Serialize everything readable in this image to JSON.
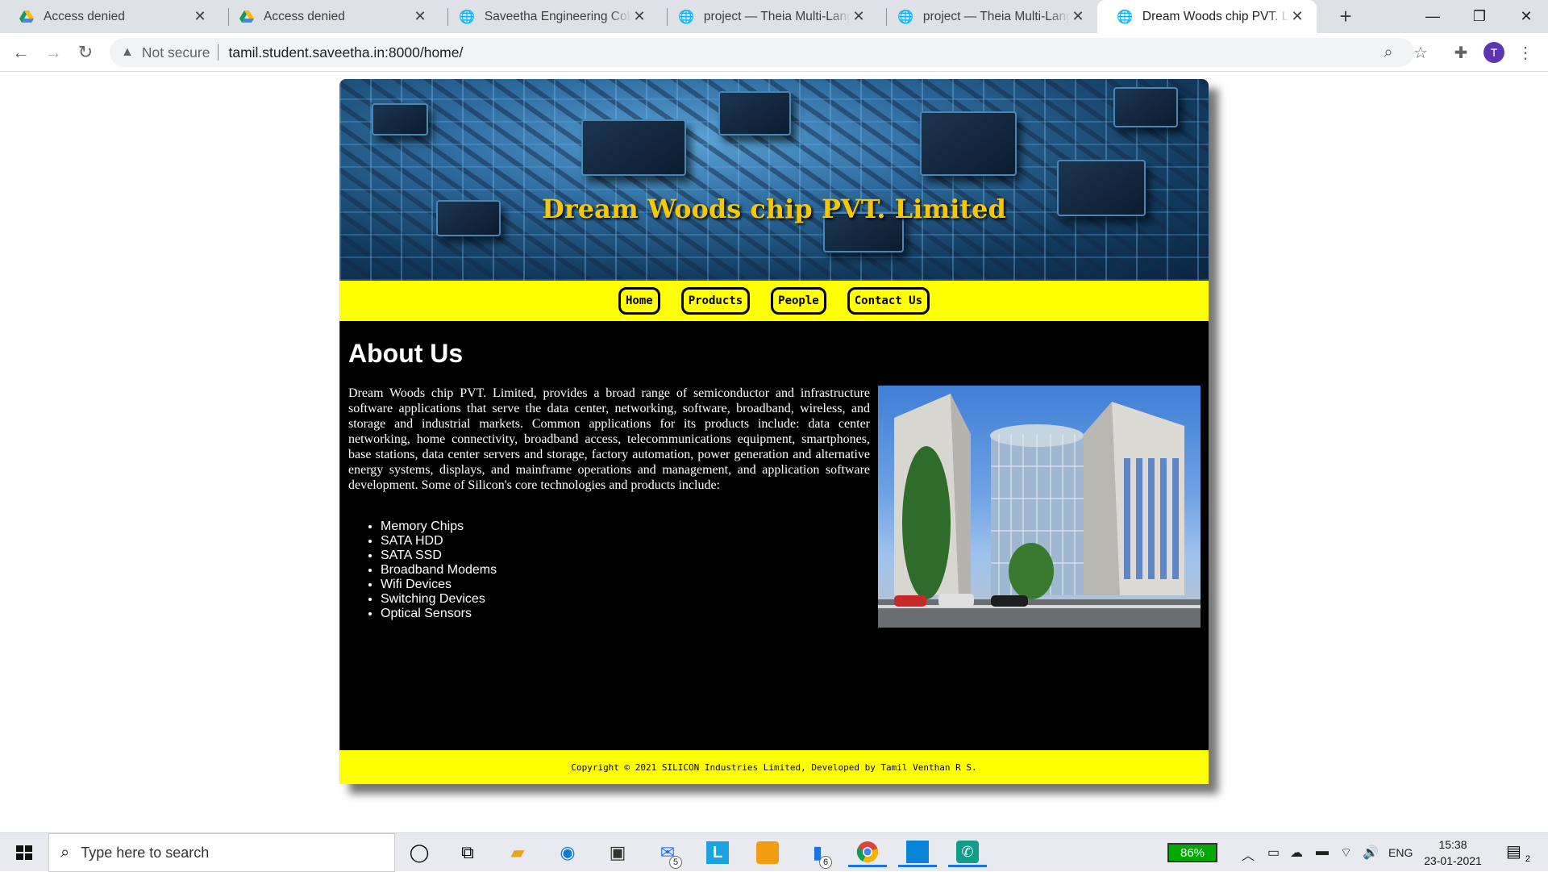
{
  "browser": {
    "tabs": [
      {
        "title": "Access denied",
        "icon": "google-drive-icon",
        "active": false
      },
      {
        "title": "Access denied",
        "icon": "google-drive-icon",
        "active": false
      },
      {
        "title": "Saveetha Engineering College",
        "icon": "globe-icon",
        "active": false
      },
      {
        "title": "project — Theia Multi-Language",
        "icon": "globe-icon",
        "active": false
      },
      {
        "title": "project — Theia Multi-Language",
        "icon": "globe-icon",
        "active": false
      },
      {
        "title": "Dream Woods chip PVT. Limited",
        "icon": "globe-icon",
        "active": true
      }
    ],
    "security_label": "Not secure",
    "url": "tamil.student.saveetha.in:8000/home/",
    "profile_initial": "T"
  },
  "site": {
    "title": "Dream Woods chip PVT. Limited",
    "nav": [
      "Home",
      "Products",
      "People",
      "Contact Us"
    ],
    "heading": "About Us",
    "paragraph": "Dream Woods chip PVT. Limited, provides a broad range of semiconductor and infrastructure software applications that serve the data center, networking, software, broadband, wireless, and storage and industrial markets. Common applications for its products include: data center networking, home connectivity, broadband access, telecommunications equipment, smartphones, base stations, data center servers and storage, factory automation, power generation and alternative energy systems, displays, and mainframe operations and management, and application software development. Some of Silicon's core technologies and products include:",
    "products": [
      "Memory Chips",
      "SATA HDD",
      "SATA SSD",
      "Broadband Modems",
      "Wifi Devices",
      "Switching Devices",
      "Optical Sensors"
    ],
    "footer": "Copyright © 2021 SILICON Industries Limited, Developed by Tamil Venthan R S.",
    "colors": {
      "accent": "#ffff00",
      "title": "#f6c800",
      "content_bg": "#000000"
    }
  },
  "taskbar": {
    "search_placeholder": "Type here to search",
    "battery": "86%",
    "language": "ENG",
    "time": "15:38",
    "date": "23-01-2021",
    "mail_badge": "5",
    "files_badge": "6",
    "notification_count": "2"
  }
}
